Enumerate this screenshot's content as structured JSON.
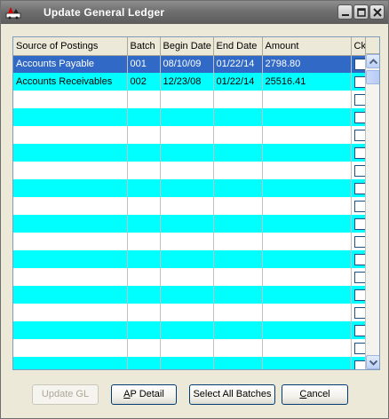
{
  "window": {
    "title": "Update General Ledger"
  },
  "grid": {
    "columns": [
      "Source of Postings",
      "Batch",
      "Begin Date",
      "End Date",
      "Amount",
      "Ck"
    ],
    "rows": [
      {
        "source": "Accounts Payable",
        "batch": "001",
        "begin": "08/10/09",
        "end": "01/22/14",
        "amount": "2798.80",
        "selected": true
      },
      {
        "source": "Accounts Receivables",
        "batch": "002",
        "begin": "12/23/08",
        "end": "01/22/14",
        "amount": "25516.41",
        "selected": false
      }
    ],
    "empty_rows": 16,
    "colors": {
      "alt_row": "#00ffff",
      "selected_row": "#3169c6"
    }
  },
  "buttons": {
    "update_gl": "Update GL",
    "ap_detail_prefix": "A",
    "ap_detail_rest": "P Detail",
    "select_all": "Select All Batches",
    "cancel_prefix": "C",
    "cancel_rest": "ancel"
  }
}
